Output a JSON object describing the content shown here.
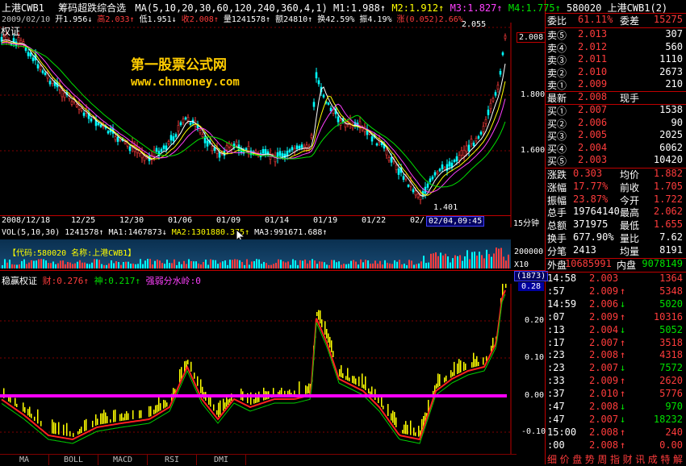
{
  "header": {
    "title": "上港CWB1",
    "indicator_name": "筹码超跌综合选",
    "ma_params": "MA(5,10,20,30,60,120,240,360,4,1)",
    "m1": "M1:1.988↑",
    "m2": "M2:1.912↑",
    "m3": "M3:1.827↑",
    "m4": "M4:1.775↑"
  },
  "bar_info": {
    "date": "2009/02/10",
    "open": "开1.956↓",
    "high": "高2.033↑",
    "low": "低1.951↓",
    "close": "收2.008↑",
    "volume": "量1241578↑",
    "amount": "额24810↑",
    "turnover": "换42.59%",
    "amplitude": "振4.19%",
    "change": "涨(0.052)2.66%"
  },
  "main_chart": {
    "label": "权证",
    "high_label": "2.055",
    "low_label": "1.401",
    "price_tag": "2.008",
    "price_ticks": [
      "1.800",
      "1.600"
    ],
    "dates": [
      "2008/12/18",
      "12/25",
      "12/30",
      "01/06",
      "01/09",
      "01/14",
      "01/19",
      "01/22",
      "02/",
      "02/04,09:45"
    ],
    "period": "15分钟"
  },
  "volume": {
    "params": "VOL(5,10,30)",
    "vol": "1241578↑",
    "ma1": "MA1:1467873↓",
    "ma2": "MA2:1301880.375↑",
    "ma3": "MA3:991671.688↑",
    "info": "【代码:580020 名称:上港CWB1】",
    "tick": "200000",
    "unit": "X10"
  },
  "indicator": {
    "label": "稳赢权证",
    "cai": "财:0.276↑",
    "shen": "神:0.217↑",
    "divide": "强弱分水岭:0",
    "readout": "(1873)",
    "value": "0.28",
    "ticks": [
      "0.20",
      "0.10",
      "0.00",
      "-0.10"
    ]
  },
  "tabs": [
    "MA",
    "BOLL",
    "MACD",
    "RSI",
    "DMI"
  ],
  "watermark": {
    "line1": "第一股票公式网",
    "line2": "www.chnmoney.com"
  },
  "quote": {
    "code_name": "580020 上港CWB1(2)",
    "weibi_label": "委比",
    "weibi": "61.11%",
    "weicha_label": "委差",
    "weicha": "15275",
    "asks": [
      {
        "label": "卖⑤",
        "price": "2.013",
        "vol": "307"
      },
      {
        "label": "卖④",
        "price": "2.012",
        "vol": "560"
      },
      {
        "label": "卖③",
        "price": "2.011",
        "vol": "1110"
      },
      {
        "label": "卖②",
        "price": "2.010",
        "vol": "2673"
      },
      {
        "label": "卖①",
        "price": "2.009",
        "vol": "210"
      }
    ],
    "latest_label": "最新",
    "latest": "2.008",
    "xianshou_label": "现手",
    "bids": [
      {
        "label": "买①",
        "price": "2.007",
        "vol": "1538"
      },
      {
        "label": "买②",
        "price": "2.006",
        "vol": "90"
      },
      {
        "label": "买③",
        "price": "2.005",
        "vol": "2025"
      },
      {
        "label": "买④",
        "price": "2.004",
        "vol": "6062"
      },
      {
        "label": "买⑤",
        "price": "2.003",
        "vol": "10420"
      }
    ],
    "stats": [
      {
        "l1": "涨跌",
        "v1": "0.303",
        "l2": "均价",
        "v2": "1.882"
      },
      {
        "l1": "涨幅",
        "v1": "17.77%",
        "l2": "前收",
        "v2": "1.705"
      },
      {
        "l1": "振幅",
        "v1": "23.87%",
        "l2": "今开",
        "v2": "1.722"
      },
      {
        "l1": "总手",
        "v1": "19764140",
        "l2": "最高",
        "v2": "2.062"
      },
      {
        "l1": "总额",
        "v1": "371975",
        "l2": "最低",
        "v2": "1.655"
      },
      {
        "l1": "换手",
        "v1": "677.90%",
        "l2": "量比",
        "v2": "7.62"
      },
      {
        "l1": "分笔",
        "v1": "2413",
        "l2": "均量",
        "v2": "8191"
      }
    ],
    "waipan_label": "外盘",
    "waipan": "10685991",
    "neipan_label": "内盘",
    "neipan": "9078149"
  },
  "ticks": [
    {
      "time": "14:58",
      "price": "2.003",
      "arrow": "",
      "vol": "1364"
    },
    {
      "time": ":57",
      "price": "2.009",
      "arrow": "↑",
      "vol": "5348"
    },
    {
      "time": "14:59",
      "price": "2.006",
      "arrow": "↓",
      "vol": "5020"
    },
    {
      "time": ":07",
      "price": "2.009",
      "arrow": "↑",
      "vol": "10316"
    },
    {
      "time": ":13",
      "price": "2.004",
      "arrow": "↓",
      "vol": "5052"
    },
    {
      "time": ":17",
      "price": "2.007",
      "arrow": "↑",
      "vol": "3518"
    },
    {
      "time": ":23",
      "price": "2.008",
      "arrow": "↑",
      "vol": "4318"
    },
    {
      "time": ":23",
      "price": "2.007",
      "arrow": "↓",
      "vol": "7572"
    },
    {
      "time": ":33",
      "price": "2.009",
      "arrow": "↑",
      "vol": "2620"
    },
    {
      "time": ":37",
      "price": "2.010",
      "arrow": "↑",
      "vol": "5776"
    },
    {
      "time": ":47",
      "price": "2.008",
      "arrow": "↓",
      "vol": "970"
    },
    {
      "time": ":47",
      "price": "2.007",
      "arrow": "↓",
      "vol": "18232"
    },
    {
      "time": "15:00",
      "price": "2.008",
      "arrow": "↑",
      "vol": "240"
    },
    {
      "time": ":00",
      "price": "2.008",
      "arrow": "↑",
      "vol": "0.00"
    }
  ],
  "bottom_tabs": [
    "细",
    "价",
    "盘",
    "势",
    "周",
    "指",
    "财",
    "讯",
    "成",
    "特",
    "解"
  ],
  "colors": {
    "up": "#ff3c3c",
    "down": "#00e000",
    "zero_line": "#ff00ff",
    "cyan_tag": "#00ffff",
    "ma_yellow": "#ffff00"
  }
}
